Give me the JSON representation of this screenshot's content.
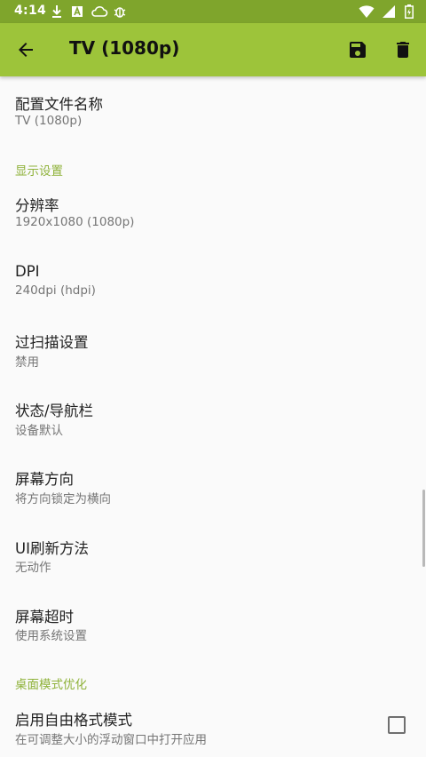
{
  "status_bar": {
    "time": "4:14",
    "notification_icons": [
      "download-icon",
      "a-box-icon",
      "cloud-icon",
      "bug-icon"
    ],
    "system_icons": [
      "wifi-icon",
      "signal-icon",
      "battery-icon"
    ]
  },
  "app_bar": {
    "title": "TV (1080p)",
    "color": "#9dc43a",
    "status_color": "#7fa52c"
  },
  "preferences": {
    "profile_name": {
      "title": "配置文件名称",
      "summary": "TV (1080p)"
    },
    "display_category": "显示设置",
    "resolution": {
      "title": "分辨率",
      "summary": "1920x1080 (1080p)"
    },
    "dpi": {
      "title": "DPI",
      "summary": "240dpi (hdpi)"
    },
    "overscan": {
      "title": "过扫描设置",
      "summary": "禁用"
    },
    "status_nav_bar": {
      "title": "状态/导航栏",
      "summary": "设备默认"
    },
    "orientation": {
      "title": "屏幕方向",
      "summary": "将方向锁定为横向"
    },
    "ui_refresh": {
      "title": "UI刷新方法",
      "summary": "无动作"
    },
    "screen_timeout": {
      "title": "屏幕超时",
      "summary": "使用系统设置"
    },
    "desktop_category": "桌面模式优化",
    "freeform": {
      "title": "启用自由格式模式",
      "summary": "在可调整大小的浮动窗口中打开应用",
      "checked": false
    }
  }
}
